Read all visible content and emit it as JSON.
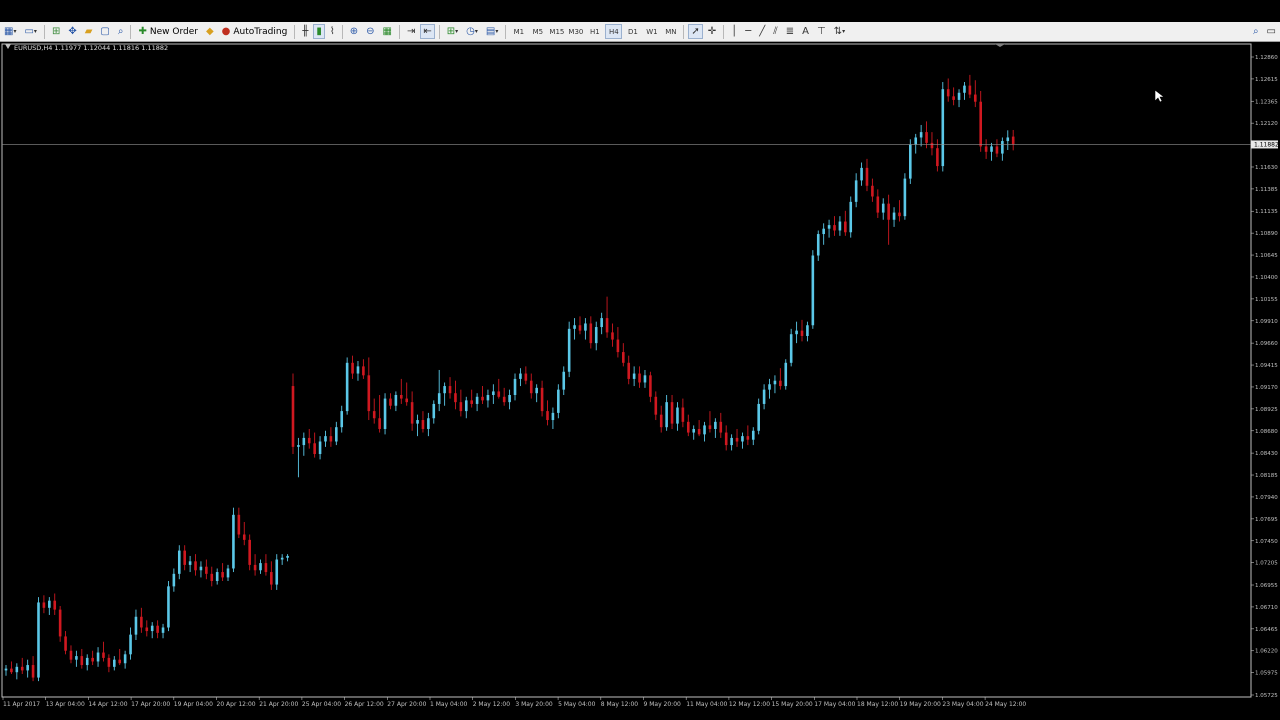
{
  "toolbar": {
    "new_order_label": "New Order",
    "autotrading_label": "AutoTrading",
    "timeframes": [
      "M1",
      "M5",
      "M15",
      "M30",
      "H1",
      "H4",
      "D1",
      "W1",
      "MN"
    ],
    "active_timeframe": "H4"
  },
  "chart": {
    "info_label": "EURUSD,H4  1.11977 1.12044 1.11816 1.11882",
    "current_price": "1.11882",
    "colors": {
      "bull": "#5bc8e8",
      "bear": "#d01820",
      "background": "#000000",
      "axis": "#c0c0c0"
    }
  },
  "chart_data": {
    "type": "candlestick",
    "symbol": "EURUSD",
    "timeframe": "H4",
    "ylim": [
      1.05725,
      1.1286
    ],
    "price_ticks": [
      "1.12860",
      "1.12615",
      "1.12365",
      "1.12120",
      "1.11882",
      "1.11630",
      "1.11385",
      "1.11135",
      "1.10890",
      "1.10645",
      "1.10400",
      "1.10155",
      "1.09910",
      "1.09660",
      "1.09415",
      "1.09170",
      "1.08925",
      "1.08680",
      "1.08430",
      "1.08185",
      "1.07940",
      "1.07695",
      "1.07450",
      "1.07205",
      "1.06955",
      "1.06710",
      "1.06465",
      "1.06220",
      "1.05975",
      "1.05725"
    ],
    "time_labels": [
      "11 Apr 2017",
      "13 Apr 04:00",
      "14 Apr 12:00",
      "17 Apr 20:00",
      "19 Apr 04:00",
      "20 Apr 12:00",
      "21 Apr 20:00",
      "25 Apr 04:00",
      "26 Apr 12:00",
      "27 Apr 20:00",
      "1 May 04:00",
      "2 May 12:00",
      "3 May 20:00",
      "5 May 04:00",
      "8 May 12:00",
      "9 May 20:00",
      "11 May 04:00",
      "12 May 12:00",
      "15 May 20:00",
      "17 May 04:00",
      "18 May 12:00",
      "19 May 20:00",
      "23 May 04:00",
      "24 May 12:00"
    ],
    "current_price": 1.11882,
    "candles": [
      [
        1.06,
        1.0606,
        1.0594,
        1.0602
      ],
      [
        1.0602,
        1.061,
        1.0596,
        1.0598
      ],
      [
        1.0598,
        1.0608,
        1.059,
        1.0604
      ],
      [
        1.0604,
        1.0614,
        1.0596,
        1.06
      ],
      [
        1.06,
        1.0612,
        1.0592,
        1.0606
      ],
      [
        1.0606,
        1.0616,
        1.0588,
        1.0592
      ],
      [
        1.0592,
        1.0682,
        1.0588,
        1.0676
      ],
      [
        1.0676,
        1.0684,
        1.0664,
        1.067
      ],
      [
        1.067,
        1.0682,
        1.0662,
        1.0678
      ],
      [
        1.0678,
        1.0686,
        1.0662,
        1.0668
      ],
      [
        1.0668,
        1.0672,
        1.0632,
        1.0638
      ],
      [
        1.0638,
        1.0644,
        1.0618,
        1.0622
      ],
      [
        1.0622,
        1.0628,
        1.0608,
        1.0612
      ],
      [
        1.0612,
        1.0622,
        1.0604,
        1.0616
      ],
      [
        1.0616,
        1.0624,
        1.0602,
        1.0606
      ],
      [
        1.0606,
        1.0618,
        1.06,
        1.0614
      ],
      [
        1.0614,
        1.0622,
        1.0606,
        1.061
      ],
      [
        1.061,
        1.0626,
        1.0604,
        1.062
      ],
      [
        1.062,
        1.0632,
        1.061,
        1.0614
      ],
      [
        1.0614,
        1.0618,
        1.0598,
        1.0604
      ],
      [
        1.0604,
        1.0616,
        1.06,
        1.0612
      ],
      [
        1.0612,
        1.0624,
        1.0606,
        1.0608
      ],
      [
        1.0608,
        1.0622,
        1.0602,
        1.0618
      ],
      [
        1.0618,
        1.0648,
        1.0612,
        1.064
      ],
      [
        1.064,
        1.0668,
        1.0634,
        1.066
      ],
      [
        1.066,
        1.067,
        1.0642,
        1.0648
      ],
      [
        1.0648,
        1.0656,
        1.0638,
        1.0644
      ],
      [
        1.0644,
        1.0654,
        1.0636,
        1.065
      ],
      [
        1.065,
        1.0656,
        1.0636,
        1.0642
      ],
      [
        1.0642,
        1.0652,
        1.0636,
        1.0648
      ],
      [
        1.0648,
        1.07,
        1.0644,
        1.0694
      ],
      [
        1.0694,
        1.0714,
        1.0688,
        1.0708
      ],
      [
        1.0708,
        1.074,
        1.0702,
        1.0734
      ],
      [
        1.0734,
        1.074,
        1.0712,
        1.0718
      ],
      [
        1.0718,
        1.0728,
        1.071,
        1.0722
      ],
      [
        1.0722,
        1.073,
        1.0706,
        1.0712
      ],
      [
        1.0712,
        1.0722,
        1.0704,
        1.0716
      ],
      [
        1.0716,
        1.0724,
        1.0702,
        1.0708
      ],
      [
        1.0708,
        1.0716,
        1.0694,
        1.07
      ],
      [
        1.07,
        1.0714,
        1.0696,
        1.071
      ],
      [
        1.071,
        1.072,
        1.07,
        1.0704
      ],
      [
        1.0704,
        1.0718,
        1.07,
        1.0714
      ],
      [
        1.0714,
        1.0782,
        1.071,
        1.0774
      ],
      [
        1.0774,
        1.0782,
        1.0748,
        1.0752
      ],
      [
        1.0752,
        1.0766,
        1.074,
        1.0746
      ],
      [
        1.0746,
        1.0752,
        1.0712,
        1.0718
      ],
      [
        1.0718,
        1.073,
        1.0706,
        1.0712
      ],
      [
        1.0712,
        1.0724,
        1.0708,
        1.072
      ],
      [
        1.072,
        1.073,
        1.0706,
        1.071
      ],
      [
        1.071,
        1.0722,
        1.069,
        1.0696
      ],
      [
        1.0696,
        1.073,
        1.069,
        1.0724
      ],
      [
        1.0724,
        1.073,
        1.0718,
        1.0726
      ],
      [
        1.0726,
        1.073,
        1.0722,
        1.0728
      ],
      [
        1.0918,
        1.0932,
        1.0842,
        1.085
      ],
      [
        1.085,
        1.086,
        1.0816,
        1.0852
      ],
      [
        1.0852,
        1.0866,
        1.084,
        1.086
      ],
      [
        1.086,
        1.087,
        1.0848,
        1.0854
      ],
      [
        1.0854,
        1.0866,
        1.0838,
        1.0842
      ],
      [
        1.0842,
        1.0862,
        1.0836,
        1.0856
      ],
      [
        1.0856,
        1.0868,
        1.085,
        1.0862
      ],
      [
        1.0862,
        1.0872,
        1.085,
        1.0856
      ],
      [
        1.0856,
        1.0878,
        1.0852,
        1.0872
      ],
      [
        1.0872,
        1.0896,
        1.0866,
        1.089
      ],
      [
        1.089,
        1.095,
        1.0886,
        1.0944
      ],
      [
        1.0944,
        1.0952,
        1.0926,
        1.0932
      ],
      [
        1.0932,
        1.0946,
        1.0924,
        1.094
      ],
      [
        1.094,
        1.0948,
        1.0926,
        1.093
      ],
      [
        1.093,
        1.095,
        1.088,
        1.089
      ],
      [
        1.089,
        1.0904,
        1.0876,
        1.0882
      ],
      [
        1.0882,
        1.0908,
        1.0866,
        1.087
      ],
      [
        1.087,
        1.091,
        1.0864,
        1.0904
      ],
      [
        1.0904,
        1.091,
        1.0892,
        1.0896
      ],
      [
        1.0896,
        1.0912,
        1.089,
        1.0908
      ],
      [
        1.0908,
        1.0926,
        1.0898,
        1.0904
      ],
      [
        1.0904,
        1.0922,
        1.0896,
        1.09
      ],
      [
        1.09,
        1.0912,
        1.0868,
        1.0876
      ],
      [
        1.0876,
        1.0886,
        1.0862,
        1.088
      ],
      [
        1.088,
        1.089,
        1.0866,
        1.087
      ],
      [
        1.087,
        1.0888,
        1.0862,
        1.0882
      ],
      [
        1.0882,
        1.0902,
        1.0876,
        1.0898
      ],
      [
        1.0898,
        1.0936,
        1.089,
        1.091
      ],
      [
        1.091,
        1.0922,
        1.0896,
        1.0918
      ],
      [
        1.0918,
        1.0928,
        1.0904,
        1.091
      ],
      [
        1.091,
        1.0924,
        1.0892,
        1.09
      ],
      [
        1.09,
        1.0914,
        1.0884,
        1.089
      ],
      [
        1.089,
        1.0906,
        1.0882,
        1.0902
      ],
      [
        1.0902,
        1.0914,
        1.0894,
        1.0898
      ],
      [
        1.0898,
        1.091,
        1.089,
        1.0906
      ],
      [
        1.0906,
        1.0918,
        1.0898,
        1.0902
      ],
      [
        1.0902,
        1.0914,
        1.0894,
        1.0908
      ],
      [
        1.0908,
        1.092,
        1.0898,
        1.0912
      ],
      [
        1.0912,
        1.0926,
        1.0904,
        1.0906
      ],
      [
        1.0906,
        1.0916,
        1.0896,
        1.09
      ],
      [
        1.09,
        1.0914,
        1.0892,
        1.0908
      ],
      [
        1.0908,
        1.0932,
        1.0902,
        1.0926
      ],
      [
        1.0926,
        1.0938,
        1.0918,
        1.0932
      ],
      [
        1.0932,
        1.094,
        1.092,
        1.0924
      ],
      [
        1.0924,
        1.0932,
        1.0904,
        1.091
      ],
      [
        1.091,
        1.092,
        1.09,
        1.0916
      ],
      [
        1.0916,
        1.0924,
        1.0884,
        1.089
      ],
      [
        1.089,
        1.0902,
        1.0874,
        1.088
      ],
      [
        1.088,
        1.0894,
        1.087,
        1.0888
      ],
      [
        1.0888,
        1.092,
        1.0882,
        1.0914
      ],
      [
        1.0914,
        1.094,
        1.0908,
        1.0934
      ],
      [
        1.0934,
        1.099,
        1.0928,
        1.0982
      ],
      [
        1.0982,
        1.0994,
        1.097,
        1.0986
      ],
      [
        1.0986,
        1.0996,
        1.0976,
        1.098
      ],
      [
        1.098,
        1.0994,
        1.097,
        1.0988
      ],
      [
        1.0988,
        1.0996,
        1.096,
        1.0966
      ],
      [
        1.0966,
        1.099,
        1.0958,
        1.0984
      ],
      [
        1.0984,
        1.1,
        1.0976,
        1.0994
      ],
      [
        1.0994,
        1.1018,
        1.0972,
        1.0978
      ],
      [
        1.0978,
        1.0988,
        1.0962,
        1.097
      ],
      [
        1.097,
        1.0984,
        1.095,
        1.0956
      ],
      [
        1.0956,
        1.0966,
        1.094,
        1.0944
      ],
      [
        1.0944,
        1.0952,
        1.092,
        1.0926
      ],
      [
        1.0926,
        1.094,
        1.0918,
        1.0932
      ],
      [
        1.0932,
        1.094,
        1.0916,
        1.0922
      ],
      [
        1.0922,
        1.0936,
        1.0916,
        1.093
      ],
      [
        1.093,
        1.0934,
        1.09,
        1.0906
      ],
      [
        1.0906,
        1.0912,
        1.088,
        1.0886
      ],
      [
        1.0886,
        1.0896,
        1.0866,
        1.0872
      ],
      [
        1.0872,
        1.0908,
        1.0868,
        1.09
      ],
      [
        1.09,
        1.0908,
        1.087,
        1.0876
      ],
      [
        1.0876,
        1.09,
        1.0868,
        1.0894
      ],
      [
        1.0894,
        1.0904,
        1.0872,
        1.0878
      ],
      [
        1.0878,
        1.0886,
        1.0862,
        1.0866
      ],
      [
        1.0866,
        1.0874,
        1.0858,
        1.087
      ],
      [
        1.087,
        1.088,
        1.0862,
        1.0864
      ],
      [
        1.0864,
        1.0878,
        1.0856,
        1.0874
      ],
      [
        1.0874,
        1.089,
        1.0866,
        1.087
      ],
      [
        1.087,
        1.0882,
        1.086,
        1.0878
      ],
      [
        1.0878,
        1.0888,
        1.086,
        1.0866
      ],
      [
        1.0866,
        1.0874,
        1.0846,
        1.0852
      ],
      [
        1.0852,
        1.0864,
        1.0846,
        1.086
      ],
      [
        1.086,
        1.087,
        1.085,
        1.0856
      ],
      [
        1.0856,
        1.0866,
        1.0848,
        1.0862
      ],
      [
        1.0862,
        1.0874,
        1.0852,
        1.0858
      ],
      [
        1.0858,
        1.0872,
        1.0852,
        1.0868
      ],
      [
        1.0868,
        1.0904,
        1.0864,
        1.0898
      ],
      [
        1.0898,
        1.092,
        1.0892,
        1.0914
      ],
      [
        1.0914,
        1.0926,
        1.0904,
        1.092
      ],
      [
        1.092,
        1.093,
        1.091,
        1.0924
      ],
      [
        1.0924,
        1.0938,
        1.0914,
        1.0918
      ],
      [
        1.0918,
        1.0948,
        1.0914,
        1.0944
      ],
      [
        1.0944,
        1.0982,
        1.094,
        1.0976
      ],
      [
        1.0976,
        1.099,
        1.0966,
        1.098
      ],
      [
        1.098,
        1.0992,
        1.0968,
        1.0974
      ],
      [
        1.0974,
        1.099,
        1.0968,
        1.0986
      ],
      [
        1.0986,
        1.107,
        1.0982,
        1.1064
      ],
      [
        1.1064,
        1.1092,
        1.1058,
        1.1088
      ],
      [
        1.1088,
        1.11,
        1.1076,
        1.1094
      ],
      [
        1.1094,
        1.1104,
        1.1084,
        1.1098
      ],
      [
        1.1098,
        1.1108,
        1.1086,
        1.1092
      ],
      [
        1.1092,
        1.1108,
        1.1086,
        1.1102
      ],
      [
        1.1102,
        1.1114,
        1.1086,
        1.109
      ],
      [
        1.109,
        1.113,
        1.1084,
        1.1124
      ],
      [
        1.1124,
        1.1156,
        1.1118,
        1.1148
      ],
      [
        1.1148,
        1.1168,
        1.1142,
        1.1162
      ],
      [
        1.1162,
        1.1172,
        1.1136,
        1.1142
      ],
      [
        1.1142,
        1.115,
        1.1124,
        1.113
      ],
      [
        1.113,
        1.1138,
        1.1106,
        1.1112
      ],
      [
        1.1112,
        1.1128,
        1.1104,
        1.1122
      ],
      [
        1.1122,
        1.1132,
        1.1076,
        1.1104
      ],
      [
        1.1104,
        1.1118,
        1.1096,
        1.1112
      ],
      [
        1.1112,
        1.1126,
        1.1102,
        1.1108
      ],
      [
        1.1108,
        1.1156,
        1.1104,
        1.115
      ],
      [
        1.115,
        1.1194,
        1.1144,
        1.1188
      ],
      [
        1.1188,
        1.12,
        1.1178,
        1.1196
      ],
      [
        1.1196,
        1.121,
        1.1186,
        1.1202
      ],
      [
        1.1202,
        1.1214,
        1.1184,
        1.119
      ],
      [
        1.119,
        1.1202,
        1.1176,
        1.1184
      ],
      [
        1.1184,
        1.1194,
        1.1158,
        1.1164
      ],
      [
        1.1164,
        1.1258,
        1.1158,
        1.125
      ],
      [
        1.125,
        1.1262,
        1.1236,
        1.1242
      ],
      [
        1.1242,
        1.1252,
        1.1232,
        1.1238
      ],
      [
        1.1238,
        1.125,
        1.123,
        1.1246
      ],
      [
        1.1246,
        1.1258,
        1.1238,
        1.1254
      ],
      [
        1.1254,
        1.1266,
        1.124,
        1.1244
      ],
      [
        1.1244,
        1.126,
        1.123,
        1.1236
      ],
      [
        1.1236,
        1.1248,
        1.118,
        1.1186
      ],
      [
        1.1186,
        1.1194,
        1.1172,
        1.118
      ],
      [
        1.118,
        1.119,
        1.117,
        1.1186
      ],
      [
        1.1186,
        1.1194,
        1.1174,
        1.1178
      ],
      [
        1.1178,
        1.1196,
        1.117,
        1.1192
      ],
      [
        1.1192,
        1.1204,
        1.1182,
        1.1196
      ],
      [
        1.1197,
        1.12044,
        1.11816,
        1.11882
      ]
    ]
  }
}
